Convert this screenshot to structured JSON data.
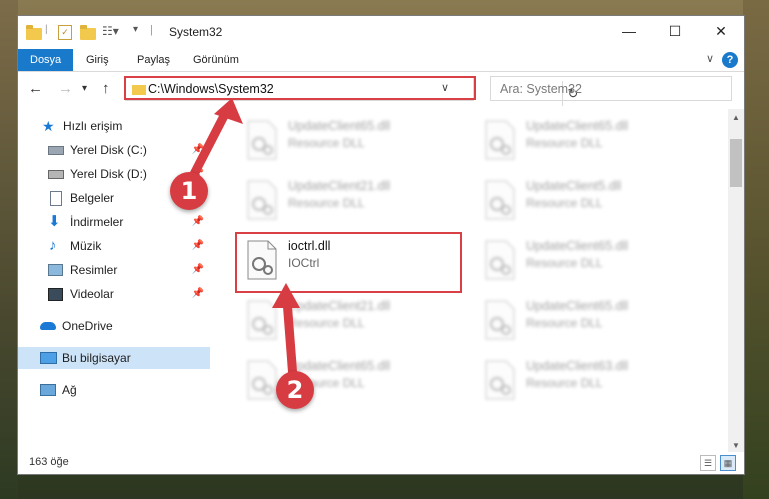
{
  "window": {
    "title": "System32"
  },
  "ribbon": {
    "tabs": [
      {
        "label": "Dosya",
        "active": true
      },
      {
        "label": "Giriş"
      },
      {
        "label": "Paylaş"
      },
      {
        "label": "Görünüm"
      }
    ],
    "help_label": "?"
  },
  "address": {
    "path": "C:\\Windows\\System32"
  },
  "search": {
    "placeholder": "Ara: System32"
  },
  "sidebar": {
    "items": [
      {
        "label": "Hızlı erişim",
        "icon": "star-icon"
      },
      {
        "label": "Yerel Disk (C:)",
        "icon": "drive-icon",
        "pinned": true
      },
      {
        "label": "Yerel Disk (D:)",
        "icon": "drive-icon",
        "pinned": true
      },
      {
        "label": "Belgeler",
        "icon": "documents-icon",
        "pinned": true
      },
      {
        "label": "İndirmeler",
        "icon": "download-icon",
        "pinned": true
      },
      {
        "label": "Müzik",
        "icon": "music-icon",
        "pinned": true
      },
      {
        "label": "Resimler",
        "icon": "pictures-icon",
        "pinned": true
      },
      {
        "label": "Videolar",
        "icon": "videos-icon",
        "pinned": true
      },
      {
        "label": "OneDrive",
        "icon": "cloud-icon"
      },
      {
        "label": "Bu bilgisayar",
        "icon": "computer-icon",
        "selected": true
      },
      {
        "label": "Ağ",
        "icon": "network-icon"
      }
    ]
  },
  "files": [
    {
      "name": "UpdateClient65.dll",
      "type": "Resource DLL"
    },
    {
      "name": "UpdateClient65.dll",
      "type": "Resource DLL"
    },
    {
      "name": "UpdateClient21.dll",
      "type": "Resource DLL"
    },
    {
      "name": "UpdateClient5.dll",
      "type": "Resource DLL"
    },
    {
      "name": "ioctrl.dll",
      "type": "IOCtrl"
    },
    {
      "name": "UpdateClient65.dll",
      "type": "Resource DLL"
    },
    {
      "name": "UpdateClient21.dll",
      "type": "Resource DLL"
    },
    {
      "name": "UpdateClient65.dll",
      "type": "Resource DLL"
    },
    {
      "name": "UpdateClient65.dll",
      "type": "Resource DLL"
    },
    {
      "name": "UpdateClient63.dll",
      "type": "Resource DLL"
    }
  ],
  "status": {
    "count": "163 öğe"
  },
  "annotations": {
    "step1": "1",
    "step2": "2",
    "color": "#d63c42"
  }
}
